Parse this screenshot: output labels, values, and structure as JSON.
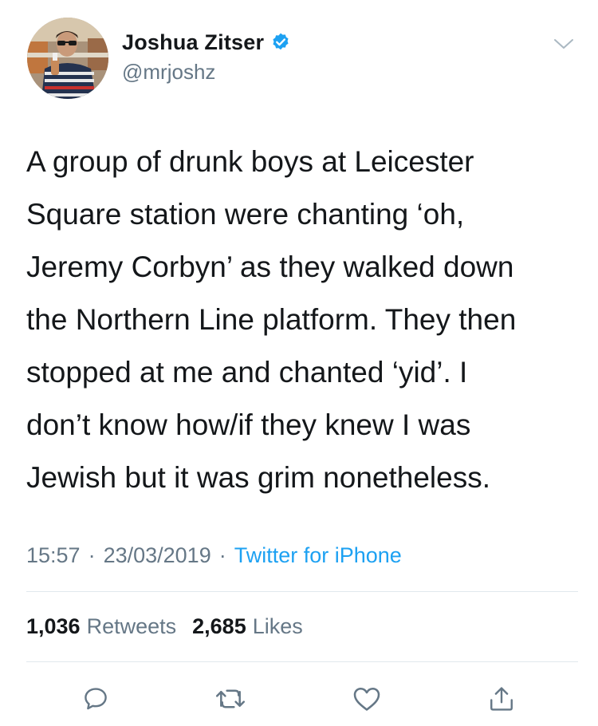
{
  "author": {
    "display_name": "Joshua Zitser",
    "handle": "@mrjoshz",
    "verified": true
  },
  "tweet": {
    "text_lines": [
      "A group of drunk boys at Leicester",
      "Square station were chanting ‘oh,",
      "Jeremy Corbyn’ as they walked down",
      "the Northern Line platform. They then",
      "stopped at me and chanted ‘yid’. I",
      "don’t know how/if they knew I was",
      "Jewish but it was grim nonetheless."
    ],
    "time": "15:57",
    "date": "23/03/2019",
    "separator": "·",
    "source": "Twitter for iPhone"
  },
  "stats": {
    "retweets_count": "1,036",
    "retweets_label": "Retweets",
    "likes_count": "2,685",
    "likes_label": "Likes"
  },
  "actions": {
    "reply_icon": "reply-icon",
    "retweet_icon": "retweet-icon",
    "like_icon": "heart-icon",
    "share_icon": "share-icon"
  },
  "colors": {
    "text": "#14171a",
    "secondary": "#657786",
    "link": "#1da1f2",
    "verified": "#1da1f2",
    "divider": "#e1e8ed"
  }
}
